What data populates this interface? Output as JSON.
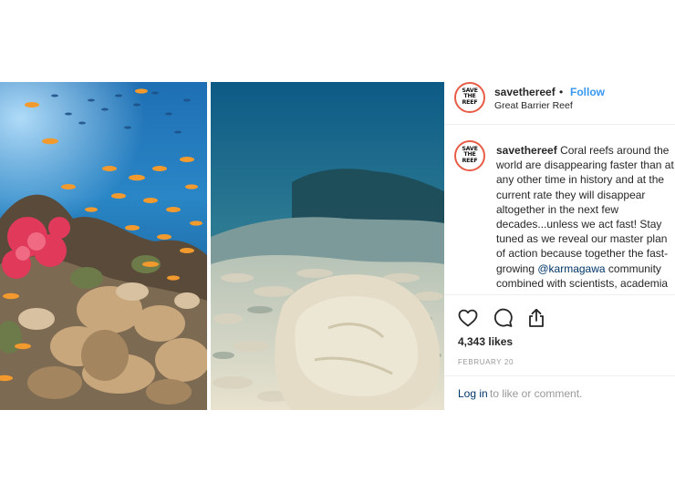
{
  "post": {
    "account": {
      "username": "savethereef",
      "avatar_text_lines": [
        "SAVE",
        "THE",
        "REEF"
      ],
      "follow_label": "Follow",
      "separator": "•",
      "location": "Great Barrier Reef"
    },
    "caption": {
      "username": "savethereef",
      "text_before_mention": "Coral reefs around the world are disappearing faster than at any other time in history and at the current rate they will disappear altogether in the next few decades...unless we act fast! Stay tuned as we reveal our master plan of action because together the fast-growing ",
      "mention": "@karmagawa",
      "text_after_mention": " community combined with scientists, academia and several charity organizations, w"
    },
    "actions": {
      "like_icon": "heart-icon",
      "comment_icon": "comment-bubble-icon",
      "share_icon": "share-icon"
    },
    "likes": "4,343 likes",
    "date": "FEBRUARY 20",
    "comment_prompt": {
      "login_label": "Log in",
      "rest_label": "to like or comment."
    }
  },
  "media": {
    "left_image": "healthy coral reef with orange fish",
    "right_image": "bleached dead coral reef"
  },
  "colors": {
    "link_blue": "#3897f0",
    "mention_blue": "#003569",
    "muted_gray": "#999999",
    "avatar_ring": "#e85c46",
    "divider": "#efefef"
  }
}
